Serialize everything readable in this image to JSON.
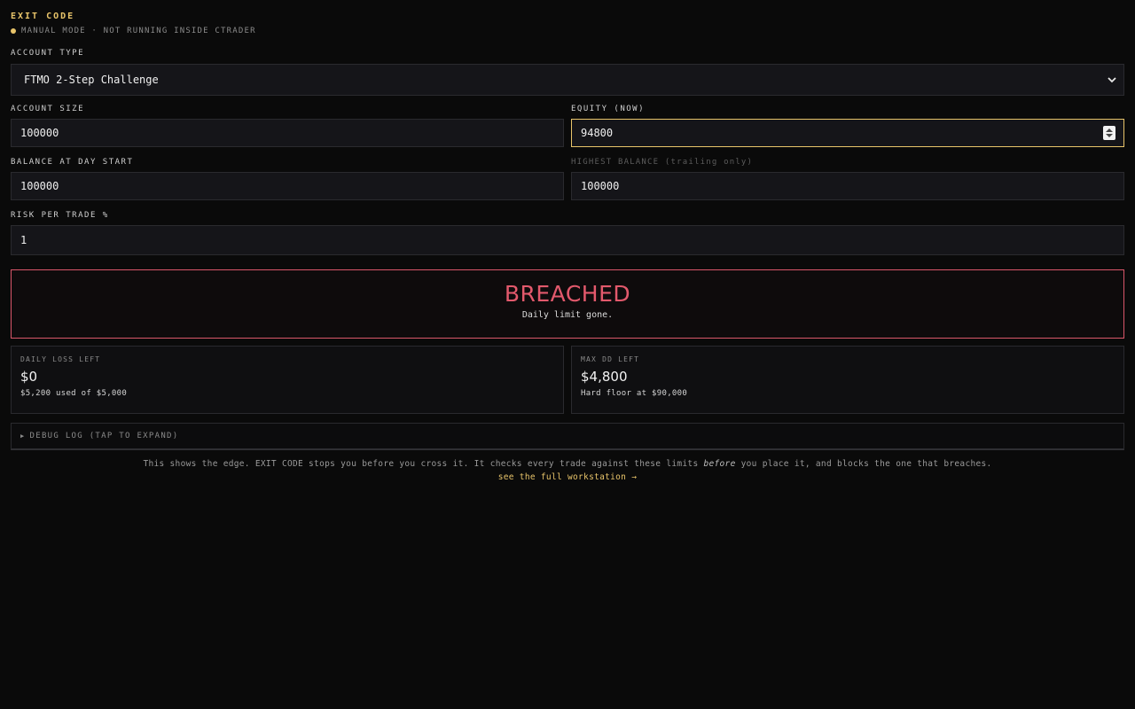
{
  "app": {
    "title": "EXIT CODE",
    "mode": "MANUAL MODE · NOT RUNNING INSIDE CTRADER"
  },
  "form": {
    "account_type": {
      "label": "ACCOUNT TYPE",
      "value": "FTMO 2-Step Challenge"
    },
    "account_size": {
      "label": "ACCOUNT SIZE",
      "value": "100000"
    },
    "equity": {
      "label": "EQUITY (NOW)",
      "value": "94800"
    },
    "balance_day_start": {
      "label": "BALANCE AT DAY START",
      "value": "100000"
    },
    "highest_balance": {
      "label": "HIGHEST BALANCE (trailing only)",
      "value": "100000"
    },
    "risk_per_trade": {
      "label": "RISK PER TRADE %",
      "value": "1"
    }
  },
  "status": {
    "title": "BREACHED",
    "message": "Daily limit gone."
  },
  "cards": {
    "daily": {
      "label": "DAILY LOSS LEFT",
      "value": "$0",
      "detail": "$5,200 used of $5,000"
    },
    "maxdd": {
      "label": "MAX DD LEFT",
      "value": "$4,800",
      "detail": "Hard floor at $90,000"
    }
  },
  "debug": {
    "label": "DEBUG LOG (TAP TO EXPAND)"
  },
  "footer": {
    "text_before": "This shows the edge. EXIT CODE stops you before you cross it. It checks every trade against these limits ",
    "text_em": "before",
    "text_after": " you place it, and blocks the one that breaches.",
    "link": "see the full workstation →"
  },
  "colors": {
    "accent": "#e8c46a",
    "danger": "#e2596c",
    "background": "#0a0a0a"
  }
}
